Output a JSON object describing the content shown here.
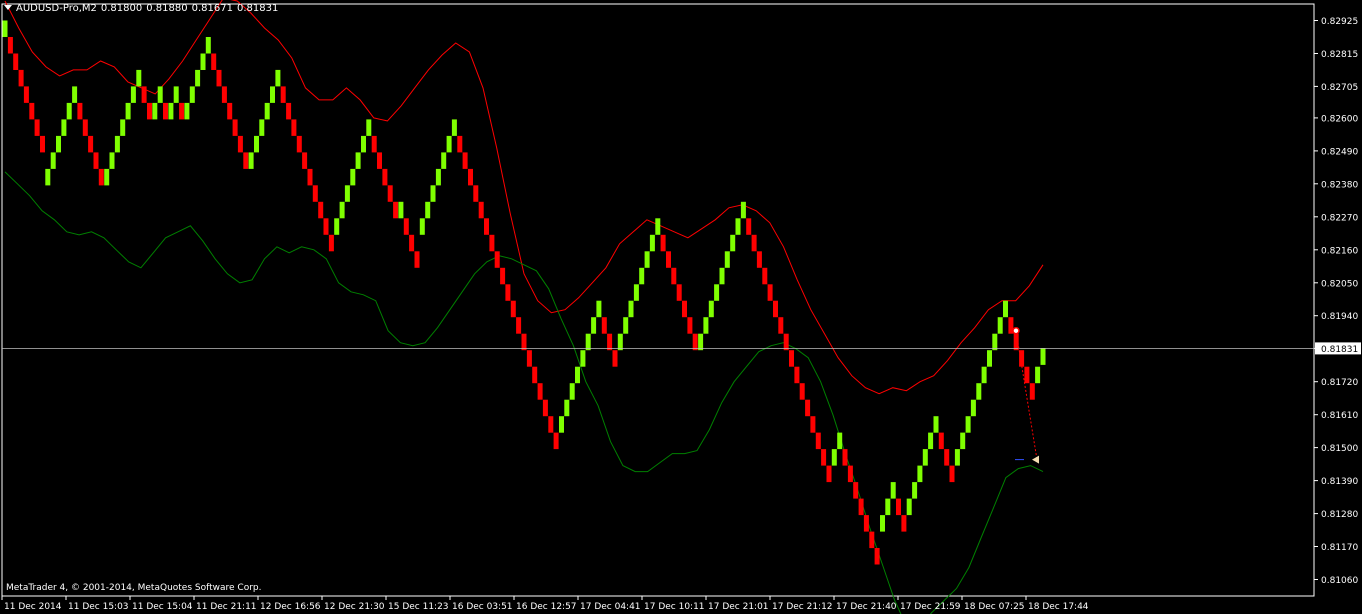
{
  "header": {
    "symbol_tf": "AUDUSD-Pro,M2",
    "open": "0.81800",
    "high": "0.81880",
    "low": "0.81671",
    "close": "0.81831"
  },
  "copyright": "MetaTrader 4, © 2001-2014, MetaQuotes Software Corp.",
  "colors": {
    "background": "#000000",
    "axis": "#ffffff",
    "bull": "#7fff00",
    "bear": "#ff0000",
    "upper_band": "#ff0000",
    "lower_band": "#008000",
    "price_line": "#c0c0c0"
  },
  "chart_data": {
    "type": "renko",
    "symbol": "AUDUSD-Pro",
    "timeframe": "M2",
    "brick_size": 0.00055,
    "y_ticks": [
      "0.82925",
      "0.82815",
      "0.82705",
      "0.82600",
      "0.82490",
      "0.82380",
      "0.82270",
      "0.82160",
      "0.82050",
      "0.81940",
      "0.81831",
      "0.81720",
      "0.81610",
      "0.81500",
      "0.81390",
      "0.81280",
      "0.81170",
      "0.81060"
    ],
    "x_ticks": [
      "11 Dec 2014",
      "11 Dec 15:03",
      "11 Dec 15:04",
      "11 Dec 21:11",
      "12 Dec 16:56",
      "12 Dec 21:30",
      "15 Dec 11:23",
      "16 Dec 03:51",
      "16 Dec 12:57",
      "17 Dec 04:41",
      "17 Dec 10:11",
      "17 Dec 21:01",
      "17 Dec 21:12",
      "17 Dec 21:40",
      "17 Dec 21:59",
      "18 Dec 07:25",
      "18 Dec 17:44"
    ],
    "current_price": 0.81831,
    "ylim": [
      0.81005,
      0.8298
    ],
    "bricks": [
      {
        "dir": "up",
        "top": 0.82925
      },
      {
        "dir": "down",
        "top": 0.8287
      },
      {
        "dir": "down",
        "top": 0.82815
      },
      {
        "dir": "down",
        "top": 0.8276
      },
      {
        "dir": "down",
        "top": 0.82705
      },
      {
        "dir": "down",
        "top": 0.8265
      },
      {
        "dir": "down",
        "top": 0.82595
      },
      {
        "dir": "down",
        "top": 0.8254
      },
      {
        "dir": "up",
        "top": 0.8243
      },
      {
        "dir": "up",
        "top": 0.82485
      },
      {
        "dir": "up",
        "top": 0.8254
      },
      {
        "dir": "up",
        "top": 0.82595
      },
      {
        "dir": "up",
        "top": 0.8265
      },
      {
        "dir": "up",
        "top": 0.82705
      },
      {
        "dir": "down",
        "top": 0.8265
      },
      {
        "dir": "down",
        "top": 0.82595
      },
      {
        "dir": "down",
        "top": 0.8254
      },
      {
        "dir": "down",
        "top": 0.82485
      },
      {
        "dir": "down",
        "top": 0.8243
      },
      {
        "dir": "up",
        "top": 0.8243
      },
      {
        "dir": "up",
        "top": 0.82485
      },
      {
        "dir": "up",
        "top": 0.8254
      },
      {
        "dir": "up",
        "top": 0.82595
      },
      {
        "dir": "up",
        "top": 0.8265
      },
      {
        "dir": "up",
        "top": 0.82705
      },
      {
        "dir": "up",
        "top": 0.8276
      },
      {
        "dir": "down",
        "top": 0.82705
      },
      {
        "dir": "down",
        "top": 0.8265
      },
      {
        "dir": "up",
        "top": 0.8265
      },
      {
        "dir": "up",
        "top": 0.82705
      },
      {
        "dir": "down",
        "top": 0.8265
      },
      {
        "dir": "up",
        "top": 0.8265
      },
      {
        "dir": "up",
        "top": 0.82705
      },
      {
        "dir": "down",
        "top": 0.8265
      },
      {
        "dir": "up",
        "top": 0.8265
      },
      {
        "dir": "up",
        "top": 0.82705
      },
      {
        "dir": "up",
        "top": 0.8276
      },
      {
        "dir": "up",
        "top": 0.82815
      },
      {
        "dir": "up",
        "top": 0.8287
      },
      {
        "dir": "down",
        "top": 0.82815
      },
      {
        "dir": "down",
        "top": 0.8276
      },
      {
        "dir": "down",
        "top": 0.82705
      },
      {
        "dir": "down",
        "top": 0.8265
      },
      {
        "dir": "down",
        "top": 0.82595
      },
      {
        "dir": "down",
        "top": 0.8254
      },
      {
        "dir": "down",
        "top": 0.82485
      },
      {
        "dir": "up",
        "top": 0.82485
      },
      {
        "dir": "up",
        "top": 0.8254
      },
      {
        "dir": "up",
        "top": 0.82595
      },
      {
        "dir": "up",
        "top": 0.8265
      },
      {
        "dir": "up",
        "top": 0.82705
      },
      {
        "dir": "up",
        "top": 0.8276
      },
      {
        "dir": "down",
        "top": 0.82705
      },
      {
        "dir": "down",
        "top": 0.8265
      },
      {
        "dir": "down",
        "top": 0.82595
      },
      {
        "dir": "down",
        "top": 0.8254
      },
      {
        "dir": "down",
        "top": 0.82485
      },
      {
        "dir": "down",
        "top": 0.8243
      },
      {
        "dir": "down",
        "top": 0.82375
      },
      {
        "dir": "down",
        "top": 0.8232
      },
      {
        "dir": "down",
        "top": 0.82265
      },
      {
        "dir": "down",
        "top": 0.8221
      },
      {
        "dir": "up",
        "top": 0.82265
      },
      {
        "dir": "up",
        "top": 0.8232
      },
      {
        "dir": "up",
        "top": 0.82375
      },
      {
        "dir": "up",
        "top": 0.8243
      },
      {
        "dir": "up",
        "top": 0.82485
      },
      {
        "dir": "up",
        "top": 0.8254
      },
      {
        "dir": "up",
        "top": 0.82595
      },
      {
        "dir": "down",
        "top": 0.8254
      },
      {
        "dir": "down",
        "top": 0.82485
      },
      {
        "dir": "down",
        "top": 0.8243
      },
      {
        "dir": "down",
        "top": 0.82375
      },
      {
        "dir": "down",
        "top": 0.8232
      },
      {
        "dir": "up",
        "top": 0.8232
      },
      {
        "dir": "down",
        "top": 0.82265
      },
      {
        "dir": "down",
        "top": 0.8221
      },
      {
        "dir": "down",
        "top": 0.82155
      },
      {
        "dir": "up",
        "top": 0.82265
      },
      {
        "dir": "up",
        "top": 0.8232
      },
      {
        "dir": "up",
        "top": 0.82375
      },
      {
        "dir": "up",
        "top": 0.8243
      },
      {
        "dir": "up",
        "top": 0.82485
      },
      {
        "dir": "up",
        "top": 0.8254
      },
      {
        "dir": "up",
        "top": 0.82595
      },
      {
        "dir": "down",
        "top": 0.8254
      },
      {
        "dir": "down",
        "top": 0.82485
      },
      {
        "dir": "down",
        "top": 0.8243
      },
      {
        "dir": "down",
        "top": 0.82375
      },
      {
        "dir": "down",
        "top": 0.8232
      },
      {
        "dir": "down",
        "top": 0.82265
      },
      {
        "dir": "down",
        "top": 0.8221
      },
      {
        "dir": "down",
        "top": 0.82155
      },
      {
        "dir": "down",
        "top": 0.821
      },
      {
        "dir": "down",
        "top": 0.82045
      },
      {
        "dir": "down",
        "top": 0.8199
      },
      {
        "dir": "down",
        "top": 0.81935
      },
      {
        "dir": "down",
        "top": 0.8188
      },
      {
        "dir": "down",
        "top": 0.81825
      },
      {
        "dir": "down",
        "top": 0.8177
      },
      {
        "dir": "down",
        "top": 0.81715
      },
      {
        "dir": "down",
        "top": 0.8166
      },
      {
        "dir": "down",
        "top": 0.81605
      },
      {
        "dir": "down",
        "top": 0.8155
      },
      {
        "dir": "up",
        "top": 0.81605
      },
      {
        "dir": "up",
        "top": 0.8166
      },
      {
        "dir": "up",
        "top": 0.81715
      },
      {
        "dir": "up",
        "top": 0.8177
      },
      {
        "dir": "up",
        "top": 0.81825
      },
      {
        "dir": "up",
        "top": 0.8188
      },
      {
        "dir": "up",
        "top": 0.81935
      },
      {
        "dir": "up",
        "top": 0.8199
      },
      {
        "dir": "down",
        "top": 0.81935
      },
      {
        "dir": "down",
        "top": 0.8188
      },
      {
        "dir": "down",
        "top": 0.81825
      },
      {
        "dir": "up",
        "top": 0.8188
      },
      {
        "dir": "up",
        "top": 0.81935
      },
      {
        "dir": "up",
        "top": 0.8199
      },
      {
        "dir": "up",
        "top": 0.82045
      },
      {
        "dir": "up",
        "top": 0.821
      },
      {
        "dir": "up",
        "top": 0.82155
      },
      {
        "dir": "up",
        "top": 0.8221
      },
      {
        "dir": "up",
        "top": 0.82265
      },
      {
        "dir": "down",
        "top": 0.8221
      },
      {
        "dir": "down",
        "top": 0.82155
      },
      {
        "dir": "down",
        "top": 0.821
      },
      {
        "dir": "down",
        "top": 0.82045
      },
      {
        "dir": "down",
        "top": 0.8199
      },
      {
        "dir": "down",
        "top": 0.81935
      },
      {
        "dir": "down",
        "top": 0.8188
      },
      {
        "dir": "up",
        "top": 0.8188
      },
      {
        "dir": "up",
        "top": 0.81935
      },
      {
        "dir": "up",
        "top": 0.8199
      },
      {
        "dir": "up",
        "top": 0.82045
      },
      {
        "dir": "up",
        "top": 0.821
      },
      {
        "dir": "up",
        "top": 0.82155
      },
      {
        "dir": "up",
        "top": 0.8221
      },
      {
        "dir": "up",
        "top": 0.82265
      },
      {
        "dir": "up",
        "top": 0.8232
      },
      {
        "dir": "down",
        "top": 0.82265
      },
      {
        "dir": "down",
        "top": 0.8221
      },
      {
        "dir": "down",
        "top": 0.82155
      },
      {
        "dir": "down",
        "top": 0.821
      },
      {
        "dir": "down",
        "top": 0.82045
      },
      {
        "dir": "down",
        "top": 0.8199
      },
      {
        "dir": "down",
        "top": 0.81935
      },
      {
        "dir": "down",
        "top": 0.8188
      },
      {
        "dir": "down",
        "top": 0.81825
      },
      {
        "dir": "down",
        "top": 0.8177
      },
      {
        "dir": "down",
        "top": 0.81715
      },
      {
        "dir": "down",
        "top": 0.8166
      },
      {
        "dir": "down",
        "top": 0.81605
      },
      {
        "dir": "down",
        "top": 0.8155
      },
      {
        "dir": "down",
        "top": 0.81495
      },
      {
        "dir": "down",
        "top": 0.8144
      },
      {
        "dir": "up",
        "top": 0.81495
      },
      {
        "dir": "up",
        "top": 0.8155
      },
      {
        "dir": "down",
        "top": 0.81495
      },
      {
        "dir": "down",
        "top": 0.8144
      },
      {
        "dir": "down",
        "top": 0.81385
      },
      {
        "dir": "down",
        "top": 0.8133
      },
      {
        "dir": "down",
        "top": 0.81275
      },
      {
        "dir": "down",
        "top": 0.8122
      },
      {
        "dir": "down",
        "top": 0.81165
      },
      {
        "dir": "up",
        "top": 0.81275
      },
      {
        "dir": "up",
        "top": 0.8133
      },
      {
        "dir": "up",
        "top": 0.81385
      },
      {
        "dir": "down",
        "top": 0.8133
      },
      {
        "dir": "down",
        "top": 0.81275
      },
      {
        "dir": "up",
        "top": 0.8133
      },
      {
        "dir": "up",
        "top": 0.81385
      },
      {
        "dir": "up",
        "top": 0.8144
      },
      {
        "dir": "up",
        "top": 0.81495
      },
      {
        "dir": "up",
        "top": 0.8155
      },
      {
        "dir": "up",
        "top": 0.81605
      },
      {
        "dir": "down",
        "top": 0.8155
      },
      {
        "dir": "down",
        "top": 0.81495
      },
      {
        "dir": "down",
        "top": 0.8144
      },
      {
        "dir": "up",
        "top": 0.81495
      },
      {
        "dir": "up",
        "top": 0.8155
      },
      {
        "dir": "up",
        "top": 0.81605
      },
      {
        "dir": "up",
        "top": 0.8166
      },
      {
        "dir": "up",
        "top": 0.81715
      },
      {
        "dir": "up",
        "top": 0.8177
      },
      {
        "dir": "up",
        "top": 0.81825
      },
      {
        "dir": "up",
        "top": 0.8188
      },
      {
        "dir": "up",
        "top": 0.81935
      },
      {
        "dir": "up",
        "top": 0.8199
      },
      {
        "dir": "down",
        "top": 0.81935
      },
      {
        "dir": "down",
        "top": 0.8188
      },
      {
        "dir": "down",
        "top": 0.81825
      },
      {
        "dir": "down",
        "top": 0.8177
      },
      {
        "dir": "down",
        "top": 0.81715
      },
      {
        "dir": "up",
        "top": 0.8177
      },
      {
        "dir": "up",
        "top": 0.81831
      }
    ],
    "upper_band": [
      0.8299,
      0.829,
      0.8282,
      0.8277,
      0.8274,
      0.8276,
      0.8276,
      0.8279,
      0.8277,
      0.8272,
      0.827,
      0.8268,
      0.8273,
      0.8279,
      0.8286,
      0.8293,
      0.83,
      0.8299,
      0.8295,
      0.829,
      0.8286,
      0.828,
      0.827,
      0.8266,
      0.8266,
      0.827,
      0.8266,
      0.826,
      0.8259,
      0.8264,
      0.827,
      0.8276,
      0.8281,
      0.8285,
      0.8282,
      0.827,
      0.825,
      0.8228,
      0.8208,
      0.8199,
      0.8195,
      0.8196,
      0.82,
      0.8205,
      0.821,
      0.8218,
      0.8222,
      0.8226,
      0.8224,
      0.8222,
      0.822,
      0.8223,
      0.8226,
      0.823,
      0.8231,
      0.8229,
      0.8225,
      0.8217,
      0.8206,
      0.8196,
      0.8188,
      0.818,
      0.8174,
      0.817,
      0.8168,
      0.817,
      0.8169,
      0.8172,
      0.8174,
      0.8179,
      0.8185,
      0.819,
      0.8196,
      0.8199,
      0.8199,
      0.8204,
      0.8211
    ],
    "lower_band": [
      0.8242,
      0.8238,
      0.8234,
      0.8229,
      0.8226,
      0.8222,
      0.8221,
      0.8222,
      0.822,
      0.8216,
      0.8212,
      0.821,
      0.8215,
      0.822,
      0.8222,
      0.8224,
      0.8219,
      0.8213,
      0.8208,
      0.8205,
      0.8206,
      0.8213,
      0.8217,
      0.8215,
      0.8217,
      0.8216,
      0.8213,
      0.8205,
      0.8202,
      0.8201,
      0.8199,
      0.8189,
      0.8185,
      0.8184,
      0.8185,
      0.819,
      0.8196,
      0.8202,
      0.8208,
      0.8212,
      0.8214,
      0.8213,
      0.8211,
      0.8209,
      0.8203,
      0.8193,
      0.8184,
      0.8172,
      0.8164,
      0.8152,
      0.8144,
      0.8142,
      0.8142,
      0.8145,
      0.8148,
      0.8148,
      0.8149,
      0.8156,
      0.8165,
      0.8172,
      0.8177,
      0.8182,
      0.8184,
      0.8185,
      0.8183,
      0.818,
      0.8172,
      0.8161,
      0.8148,
      0.8136,
      0.8123,
      0.8111,
      0.8099,
      0.809,
      0.809,
      0.8095,
      0.8099,
      0.8103,
      0.811,
      0.812,
      0.813,
      0.814,
      0.8143,
      0.8144,
      0.8142
    ],
    "signal_points": [
      {
        "label": "sell",
        "price": 0.8189
      },
      {
        "label": "target",
        "price": 0.8146
      }
    ]
  }
}
